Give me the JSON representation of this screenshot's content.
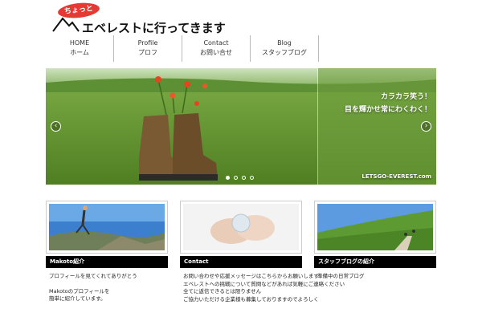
{
  "header": {
    "badge": "ちょっと",
    "title": "エベレストに行ってきます"
  },
  "nav": {
    "items": [
      {
        "en": "HOME",
        "jp": "ホーム"
      },
      {
        "en": "Profile",
        "jp": "プロフ"
      },
      {
        "en": "Contact",
        "jp": "お問い合せ"
      },
      {
        "en": "Blog",
        "jp": "スタッフブログ"
      }
    ]
  },
  "hero": {
    "line1": "カラカラ笑う！",
    "line2": "目を輝かせ常にわくわく！",
    "url": "LETSGO-EVEREST.com",
    "prev": "‹",
    "next": "›",
    "slides": 4,
    "active_slide": 1
  },
  "cards": [
    {
      "title": "Makoto紹介",
      "body": [
        "プロフィールを見てくれてありがとう",
        "",
        "Makotoのプロフィールを",
        "簡単に紹介しています。"
      ]
    },
    {
      "title": "Contact",
      "body": [
        "お問い合わせや応援メッセージはこちらからお願いします",
        "エベレストへの挑戦について質問などがあれば気軽にご連絡ください",
        "全てに返信できるとは限りません",
        "ご協力いただける企業様も募集しておりますのでよろしく"
      ]
    },
    {
      "title": "スタッフブログの紹介",
      "body": [
        "準備中の日常ブログ"
      ]
    }
  ],
  "colors": {
    "accent": "#e53935",
    "card_head_bg": "#000000"
  }
}
